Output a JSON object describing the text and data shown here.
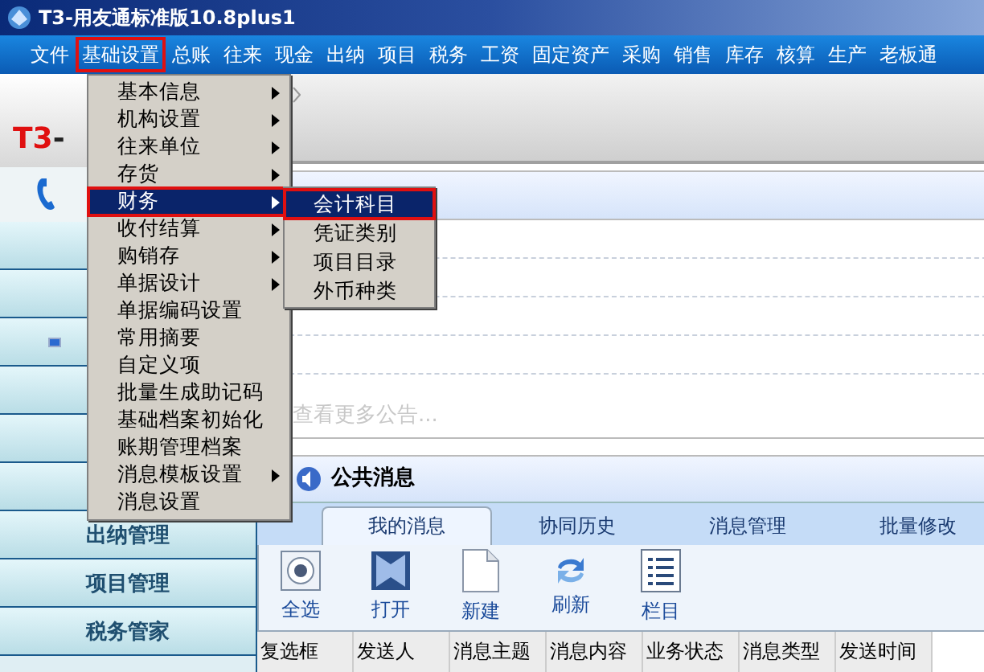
{
  "window": {
    "title": "T3-用友通标准版10.8plus1"
  },
  "menu_bar": [
    {
      "label": "文件",
      "selected": false
    },
    {
      "label": "基础设置",
      "selected": true
    },
    {
      "label": "总账",
      "selected": false
    },
    {
      "label": "往来",
      "selected": false
    },
    {
      "label": "现金",
      "selected": false
    },
    {
      "label": "出纳",
      "selected": false
    },
    {
      "label": "项目",
      "selected": false
    },
    {
      "label": "税务",
      "selected": false
    },
    {
      "label": "工资",
      "selected": false
    },
    {
      "label": "固定资产",
      "selected": false
    },
    {
      "label": "采购",
      "selected": false
    },
    {
      "label": "销售",
      "selected": false
    },
    {
      "label": "库存",
      "selected": false
    },
    {
      "label": "核算",
      "selected": false
    },
    {
      "label": "生产",
      "selected": false
    },
    {
      "label": "老板通",
      "selected": false
    }
  ],
  "dropdown": [
    {
      "label": "基本信息",
      "submenu": true,
      "selected": false
    },
    {
      "label": "机构设置",
      "submenu": true,
      "selected": false
    },
    {
      "label": "往来单位",
      "submenu": true,
      "selected": false
    },
    {
      "label": "存货",
      "submenu": true,
      "selected": false
    },
    {
      "label": "财务",
      "submenu": true,
      "selected": true
    },
    {
      "label": "收付结算",
      "submenu": true,
      "selected": false
    },
    {
      "label": "购销存",
      "submenu": true,
      "selected": false
    },
    {
      "label": "单据设计",
      "submenu": true,
      "selected": false
    },
    {
      "label": "单据编码设置",
      "submenu": false,
      "selected": false
    },
    {
      "label": "常用摘要",
      "submenu": false,
      "selected": false
    },
    {
      "label": "自定义项",
      "submenu": false,
      "selected": false
    },
    {
      "label": "批量生成助记码",
      "submenu": false,
      "selected": false
    },
    {
      "label": "基础档案初始化",
      "submenu": false,
      "selected": false
    },
    {
      "label": "账期管理档案",
      "submenu": false,
      "selected": false
    },
    {
      "label": "消息模板设置",
      "submenu": true,
      "selected": false
    },
    {
      "label": "消息设置",
      "submenu": false,
      "selected": false
    }
  ],
  "submenu": [
    {
      "label": "会计科目",
      "selected": true
    },
    {
      "label": "凭证类别",
      "selected": false
    },
    {
      "label": "项目目录",
      "selected": false
    },
    {
      "label": "外币种类",
      "selected": false
    }
  ],
  "sidebar": {
    "logo_mark": "T3",
    "logo_text": "-",
    "items": [
      {
        "label": "出纳管理"
      },
      {
        "label": "项目管理"
      },
      {
        "label": "税务管家"
      }
    ]
  },
  "announcements": {
    "more_link": "查看更多公告..."
  },
  "messages": {
    "title": "公共消息",
    "tabs": [
      {
        "label": "我的消息",
        "selected": true
      },
      {
        "label": "协同历史",
        "selected": false
      },
      {
        "label": "消息管理",
        "selected": false
      },
      {
        "label": "批量修改",
        "selected": false
      }
    ],
    "toolbar": [
      {
        "label": "全选",
        "kind": "select"
      },
      {
        "label": "打开",
        "kind": "open"
      },
      {
        "label": "新建",
        "kind": "new"
      },
      {
        "label": "刷新",
        "kind": "refresh"
      },
      {
        "label": "栏目",
        "kind": "columns"
      }
    ],
    "columns": [
      "复选框",
      "发送人",
      "消息主题",
      "消息内容",
      "业务状态",
      "消息类型",
      "发送时间"
    ]
  }
}
